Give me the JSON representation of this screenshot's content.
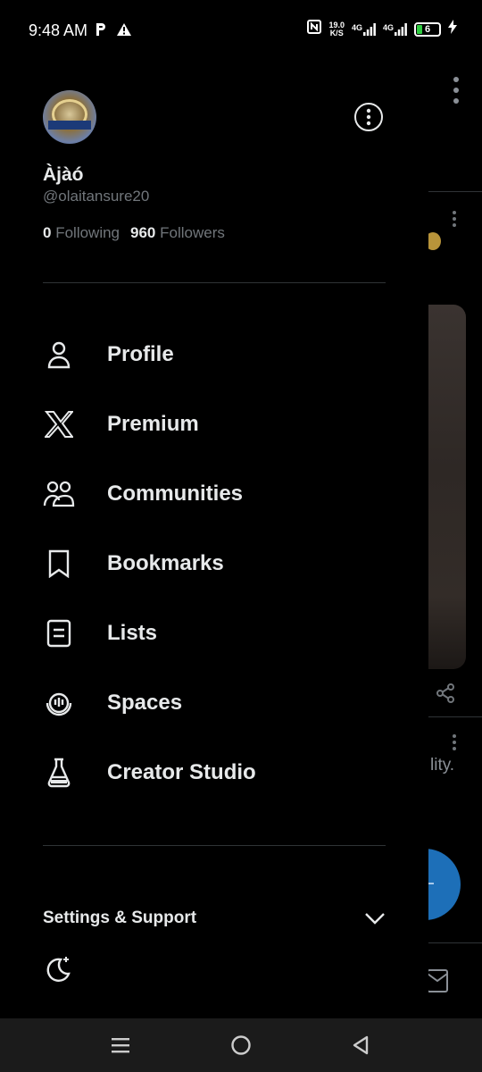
{
  "status_bar": {
    "time": "9:48 AM",
    "left_icons": [
      "parking-icon",
      "warning-icon"
    ],
    "net_speed_value": "19.0",
    "net_speed_unit": "K/S",
    "network_1": "4G",
    "network_2": "4G",
    "battery_level": "6",
    "battery_fraction": 0.06,
    "charging": true
  },
  "profile": {
    "display_name": "Àjàó",
    "handle": "@olaitansure20",
    "following_count": "0",
    "following_label": "Following",
    "followers_count": "960",
    "followers_label": "Followers"
  },
  "menu": {
    "items": [
      {
        "label": "Profile",
        "icon": "person-icon"
      },
      {
        "label": "Premium",
        "icon": "x-logo-icon"
      },
      {
        "label": "Communities",
        "icon": "communities-icon"
      },
      {
        "label": "Bookmarks",
        "icon": "bookmark-icon"
      },
      {
        "label": "Lists",
        "icon": "list-icon"
      },
      {
        "label": "Spaces",
        "icon": "spaces-icon"
      },
      {
        "label": "Creator Studio",
        "icon": "flask-icon"
      }
    ]
  },
  "settings": {
    "label": "Settings & Support",
    "icon": "chevron-down-icon"
  },
  "background": {
    "snippet_text": "lity."
  },
  "colors": {
    "background": "#000000",
    "text_primary": "#e7e9ea",
    "text_secondary": "#71767b",
    "divider": "#2f3336",
    "nav_bar": "#1b1b1b",
    "fab_blue": "#1d6fb8"
  }
}
